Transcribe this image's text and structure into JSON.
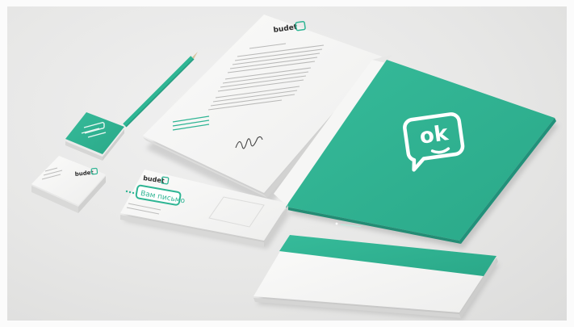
{
  "brand": {
    "name": "budet",
    "logo_mark": "ok",
    "accent": "#2fb594",
    "accent_dark": "#249a7e",
    "paper": "#f4f4f3"
  },
  "envelope": {
    "headline": "Вам письмо"
  },
  "folder": {
    "icon": "chat-bubble-ok-logo-icon"
  }
}
